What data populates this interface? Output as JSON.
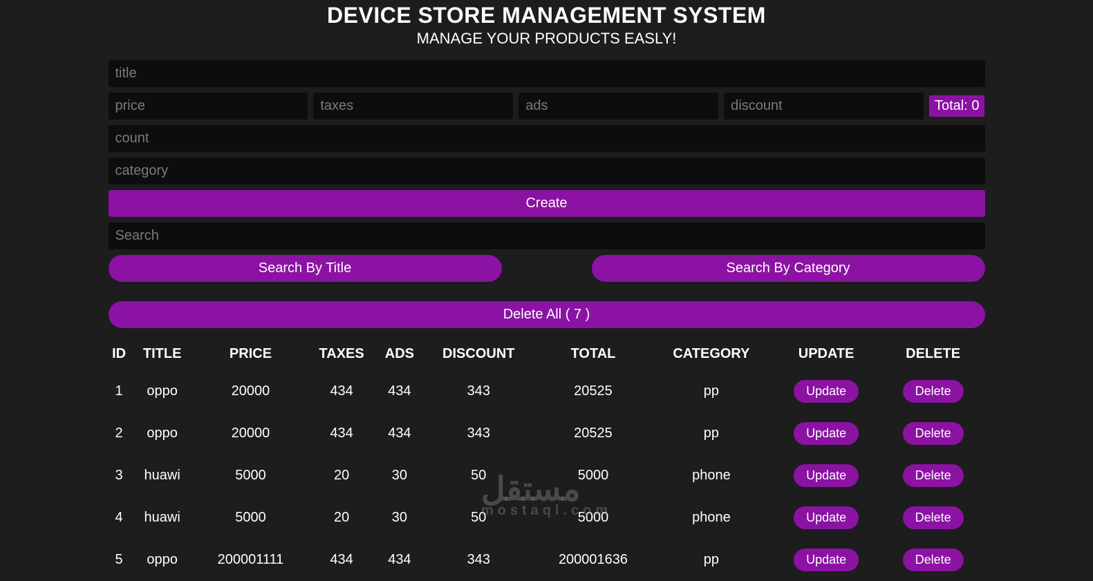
{
  "header": {
    "title": "DEVICE STORE MANAGEMENT SYSTEM",
    "subtitle": "MANAGE YOUR PRODUCTS EASLY!"
  },
  "inputs": {
    "title_placeholder": "title",
    "price_placeholder": "price",
    "taxes_placeholder": "taxes",
    "ads_placeholder": "ads",
    "discount_placeholder": "discount",
    "count_placeholder": "count",
    "category_placeholder": "category",
    "search_placeholder": "Search"
  },
  "total_label": "Total: 0",
  "buttons": {
    "create": "Create",
    "search_title": "Search By Title",
    "search_category": "Search By Category",
    "delete_all": "Delete All ( 7 )",
    "update": "Update",
    "delete": "Delete"
  },
  "table": {
    "columns": [
      "ID",
      "TITLE",
      "PRICE",
      "TAXES",
      "ADS",
      "DISCOUNT",
      "TOTAL",
      "CATEGORY",
      "UPDATE",
      "DELETE"
    ],
    "rows": [
      {
        "id": "1",
        "title": "oppo",
        "price": "20000",
        "taxes": "434",
        "ads": "434",
        "discount": "343",
        "total": "20525",
        "category": "pp"
      },
      {
        "id": "2",
        "title": "oppo",
        "price": "20000",
        "taxes": "434",
        "ads": "434",
        "discount": "343",
        "total": "20525",
        "category": "pp"
      },
      {
        "id": "3",
        "title": "huawi",
        "price": "5000",
        "taxes": "20",
        "ads": "30",
        "discount": "50",
        "total": "5000",
        "category": "phone"
      },
      {
        "id": "4",
        "title": "huawi",
        "price": "5000",
        "taxes": "20",
        "ads": "30",
        "discount": "50",
        "total": "5000",
        "category": "phone"
      },
      {
        "id": "5",
        "title": "oppo",
        "price": "200001111",
        "taxes": "434",
        "ads": "434",
        "discount": "343",
        "total": "200001636",
        "category": "pp"
      }
    ]
  },
  "watermark": {
    "main": "مستقل",
    "sub": "mostaql.com"
  }
}
